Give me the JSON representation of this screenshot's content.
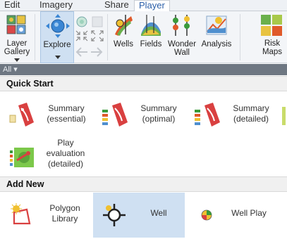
{
  "tabs": [
    "Edit",
    "Imagery",
    "Share",
    "Player"
  ],
  "ribbon": {
    "layer_gallery": "Layer Gallery",
    "explore": "Explore",
    "wells": "Wells",
    "fields": "Fields",
    "wonder_wall": "Wonder Wall",
    "analysis": "Analysis",
    "risk_maps": "Risk Maps"
  },
  "filter": "All ▾",
  "quick_start": {
    "title": "Quick Start",
    "items": [
      {
        "label": "Summary (essential)"
      },
      {
        "label": "Summary (optimal)"
      },
      {
        "label": "Summary (detailed)"
      },
      {
        "label": "Play evaluation (detailed)"
      }
    ]
  },
  "add_new": {
    "title": "Add New",
    "items": [
      {
        "label": "Polygon Library"
      },
      {
        "label": "Well",
        "selected": true
      },
      {
        "label": "Well Play"
      }
    ]
  },
  "colors": {
    "accent": "#2a5ea8",
    "selected_bg": "#cfe0f2",
    "filter_bar": "#6e7782"
  }
}
